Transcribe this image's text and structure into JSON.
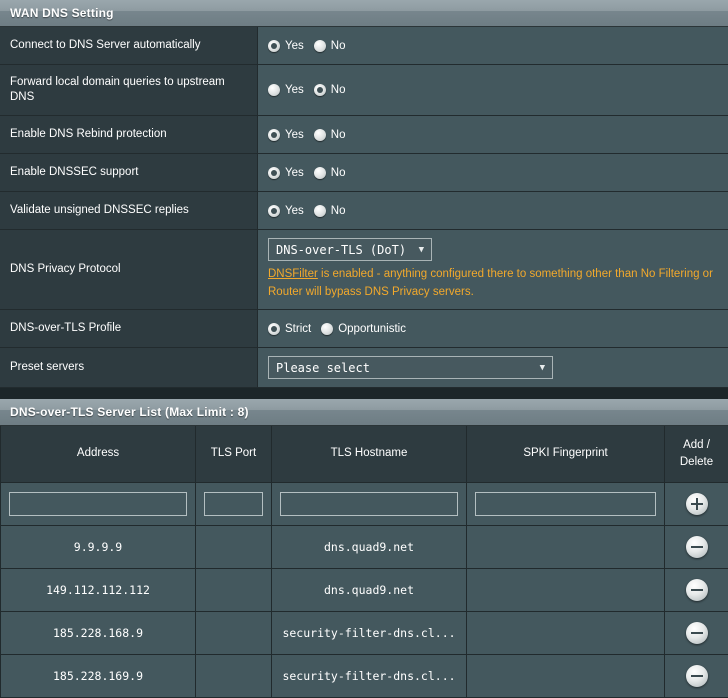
{
  "wan_dns": {
    "title": "WAN DNS Setting",
    "rows": [
      {
        "label": "Connect to DNS Server automatically",
        "type": "radio",
        "options": [
          "Yes",
          "No"
        ],
        "selected": "Yes"
      },
      {
        "label": "Forward local domain queries to upstream DNS",
        "type": "radio",
        "options": [
          "Yes",
          "No"
        ],
        "selected": "No"
      },
      {
        "label": "Enable DNS Rebind protection",
        "type": "radio",
        "options": [
          "Yes",
          "No"
        ],
        "selected": "Yes"
      },
      {
        "label": "Enable DNSSEC support",
        "type": "radio",
        "options": [
          "Yes",
          "No"
        ],
        "selected": "Yes"
      },
      {
        "label": "Validate unsigned DNSSEC replies",
        "type": "radio",
        "options": [
          "Yes",
          "No"
        ],
        "selected": "Yes"
      }
    ],
    "privacy_protocol": {
      "label": "DNS Privacy Protocol",
      "selected": "DNS-over-TLS (DoT)",
      "caret": "▼",
      "note_link": "DNSFilter",
      "note_text": " is enabled - anything configured there to something other than No Filtering or Router will bypass DNS Privacy servers."
    },
    "dot_profile": {
      "label": "DNS-over-TLS Profile",
      "options": [
        "Strict",
        "Opportunistic"
      ],
      "selected": "Strict"
    },
    "preset_servers": {
      "label": "Preset servers",
      "selected": "Please select",
      "caret": "▼"
    }
  },
  "server_list": {
    "title": "DNS-over-TLS Server List (Max Limit : 8)",
    "columns": [
      "Address",
      "TLS Port",
      "TLS Hostname",
      "SPKI Fingerprint",
      "Add / Delete"
    ],
    "action_header_line1": "Add /",
    "action_header_line2": "Delete",
    "new_row": {
      "address": "",
      "tls_port": "",
      "tls_hostname": "",
      "spki_fingerprint": "",
      "action_icon": "plus-circle-icon"
    },
    "rows": [
      {
        "address": "9.9.9.9",
        "tls_port": "",
        "tls_hostname": "dns.quad9.net",
        "spki_fingerprint": "",
        "action_icon": "minus-circle-icon"
      },
      {
        "address": "149.112.112.112",
        "tls_port": "",
        "tls_hostname": "dns.quad9.net",
        "spki_fingerprint": "",
        "action_icon": "minus-circle-icon"
      },
      {
        "address": "185.228.168.9",
        "tls_port": "",
        "tls_hostname": "security-filter-dns.cl...",
        "spki_fingerprint": "",
        "action_icon": "minus-circle-icon"
      },
      {
        "address": "185.228.169.9",
        "tls_port": "",
        "tls_hostname": "security-filter-dns.cl...",
        "spki_fingerprint": "",
        "action_icon": "minus-circle-icon"
      }
    ]
  },
  "colors": {
    "label_bg": "#2e3b40",
    "value_bg": "#44585e",
    "header_bar": "#8e9ba1",
    "warning": "#f2a92c",
    "page_bg": "#1c2629"
  }
}
